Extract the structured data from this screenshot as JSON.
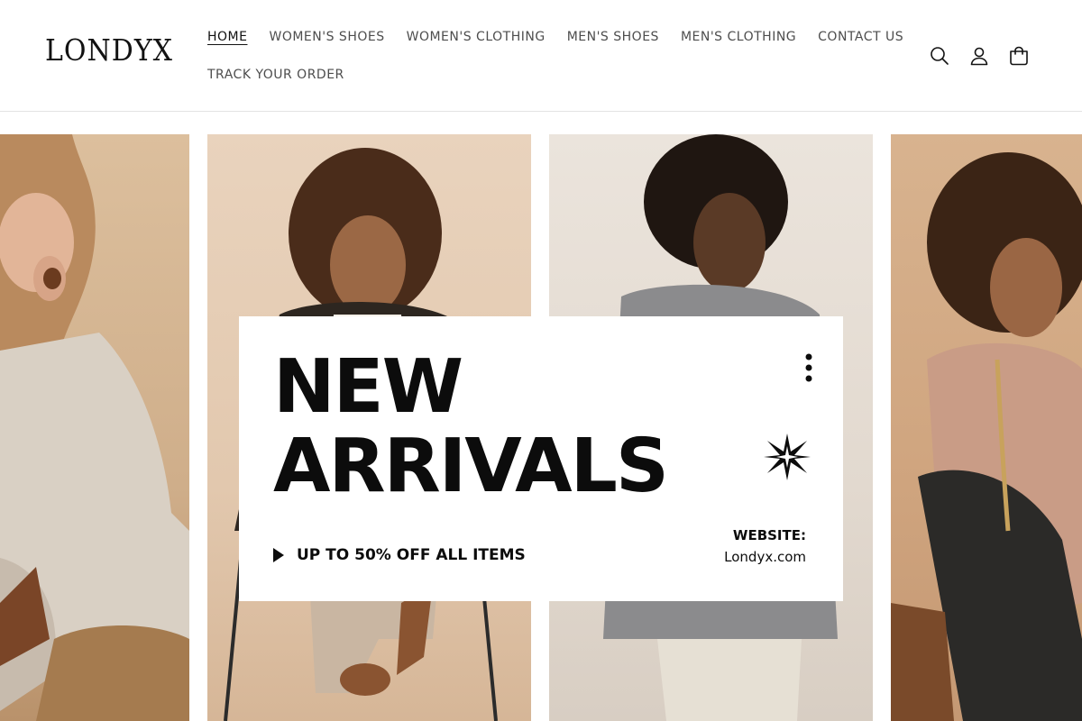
{
  "brand": {
    "logo_text": "LONDYX"
  },
  "nav": {
    "row1": [
      {
        "label": "HOME",
        "active": true
      },
      {
        "label": "WOMEN'S SHOES"
      },
      {
        "label": "WOMEN'S CLOTHING"
      },
      {
        "label": "MEN'S SHOES"
      },
      {
        "label": "MEN'S CLOTHING"
      },
      {
        "label": "CONTACT US"
      }
    ],
    "row2": [
      {
        "label": "TRACK YOUR ORDER"
      }
    ]
  },
  "header_icons": [
    "search-icon",
    "account-icon",
    "cart-icon"
  ],
  "hero": {
    "promo": {
      "line1": "NEW",
      "line2": "ARRIVALS",
      "offer": "UP TO 50% OFF ALL ITEMS",
      "website_label": "WEBSITE:",
      "website_url": "Londyx.com"
    }
  },
  "colors": {
    "text": "#121212",
    "nav_text": "#4d4d4d",
    "divider": "#e3e3e3",
    "promo_bg": "#ffffff"
  }
}
